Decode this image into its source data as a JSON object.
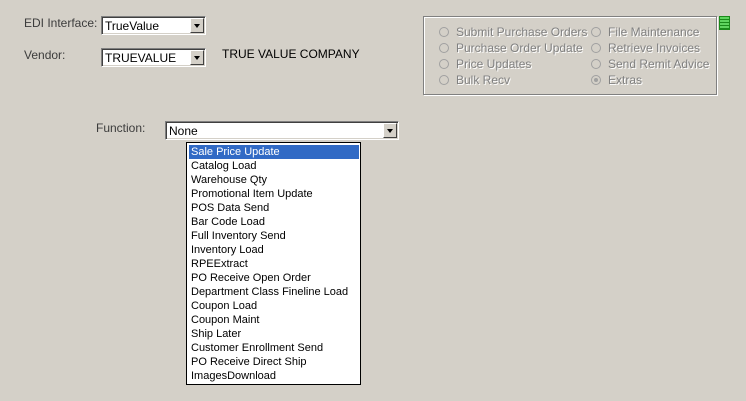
{
  "edi": {
    "label": "EDI Interface:",
    "value": "TrueValue"
  },
  "vendor": {
    "label": "Vendor:",
    "value": "TRUEVALUE",
    "name": "TRUE VALUE COMPANY"
  },
  "options": {
    "left": [
      "Submit Purchase Orders",
      "Purchase Order Update",
      "Price Updates",
      "Bulk Recv"
    ],
    "right": [
      "File Maintenance",
      "Retrieve Invoices",
      "Send Remit Advice",
      "Extras"
    ],
    "selected": "Extras"
  },
  "function": {
    "label": "Function:",
    "value": "None",
    "items": [
      "Sale Price Update",
      "Catalog Load",
      "Warehouse Qty",
      "Promotional Item Update",
      "POS Data Send",
      "Bar Code Load",
      "Full Inventory Send",
      "Inventory Load",
      "RPEExtract",
      "PO Receive Open Order",
      "Department Class Fineline Load",
      "Coupon Load",
      "Coupon Maint",
      "Ship Later",
      "Customer Enrollment Send",
      "PO Receive Direct Ship",
      "ImagesDownload"
    ],
    "highlighted": "Sale Price Update"
  },
  "icons": {
    "panel": "list-icon",
    "dropdown": "chevron-down-icon"
  },
  "colors": {
    "background": "#d4d0c8",
    "selection": "#316ac5",
    "disabled_text": "#808080"
  }
}
